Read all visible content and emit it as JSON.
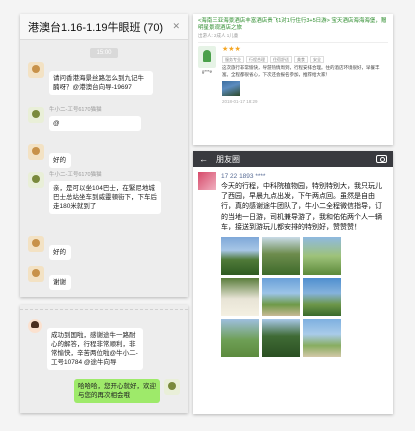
{
  "group_chat": {
    "title": "港澳台1.16-1.19牛眼班 (70)",
    "close_label": "✕",
    "time_label": "15:00",
    "messages": [
      {
        "sender": "",
        "text": "请问香港海景丝路怎么到九记牛腩呀？@港澳台向导-19697"
      },
      {
        "sender": "牛小二-工号6170猫猫",
        "text": "@"
      },
      {
        "sender": "",
        "text": "好的"
      },
      {
        "sender": "牛小二-工号6170猫猫",
        "text": "亲，是可以坐104巴士，在緊尼地城巴士总站坐车到威靈頓街下，下车后走180米就到了"
      },
      {
        "sender": "",
        "text": "好的"
      },
      {
        "sender": "",
        "text": "谢谢"
      }
    ]
  },
  "review": {
    "link": "<海南三亚海景酒店丰富酒店贵飞1对1行住行3+5日游> 宝天酒店海海海堡，赠明星景观酒店之旅",
    "meta": "出游人: 2成人 1儿童",
    "stars": "★★★",
    "tags": [
      "服务专业",
      "行程合理",
      "住宿舒适",
      "美食",
      "安全"
    ],
    "text": "这次旅行非常愉快，导游热情周到，行程安排合理。住的酒店环境很好，早餐丰富。全程都很省心，下次还会报名参加，推荐给大家！",
    "date": "2018-01-17 18:29",
    "reviewer": "g***e"
  },
  "bottom_chat": {
    "sender": "",
    "guest_text": "成功到国啦，感谢途牛一路耐心的解答，行程非常顺利，非常愉快，辛苦两位啦@牛小二-工号10784 @途牛向导",
    "my_text": "哈哈哈，您开心就好，欢迎与您的再次相会哦"
  },
  "moments": {
    "title": "朋友圈",
    "back": "←",
    "poster_name": "17 22 1893 ****",
    "post_text": "今天的行程，中科院植物园，特别特别大，我只玩儿了西园，早晨九点出发，下午两点回。虽然是自由行，真的感谢途牛团队了，牛小二全程微信指导，订的当地一日游，司机兼导游了，我和佑佑两个人一辆车，接送到游玩儿都安排的特别好，赞赞赞！"
  }
}
